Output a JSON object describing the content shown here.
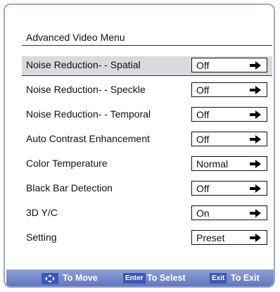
{
  "menu": {
    "title": "Advanced Video Menu",
    "rows": [
      {
        "label": "Noise Reduction- - Spatial",
        "value": "Off"
      },
      {
        "label": "Noise Reduction- - Speckle",
        "value": "Off"
      },
      {
        "label": "Noise Reduction- - Temporal",
        "value": "Off"
      },
      {
        "label": "Auto Contrast Enhancement",
        "value": "Off"
      },
      {
        "label": "Color Temperature",
        "value": "Normal"
      },
      {
        "label": "Black Bar Detection",
        "value": "Off"
      },
      {
        "label": "3D Y/C",
        "value": "On"
      },
      {
        "label": "Setting",
        "value": "Preset"
      }
    ]
  },
  "footer": {
    "move_label": "To Move",
    "enter_key": "Enter",
    "select_label": "To Selest",
    "exit_key": "Exit",
    "exit_label": "To Exit"
  },
  "icons": {
    "move": "move-arrows-icon",
    "value_arrow": "right-arrow-icon"
  },
  "colors": {
    "frame_border": "#9aa9d3",
    "selected_row": "#d9d9de",
    "footer_bar": "#6a7fc6"
  }
}
